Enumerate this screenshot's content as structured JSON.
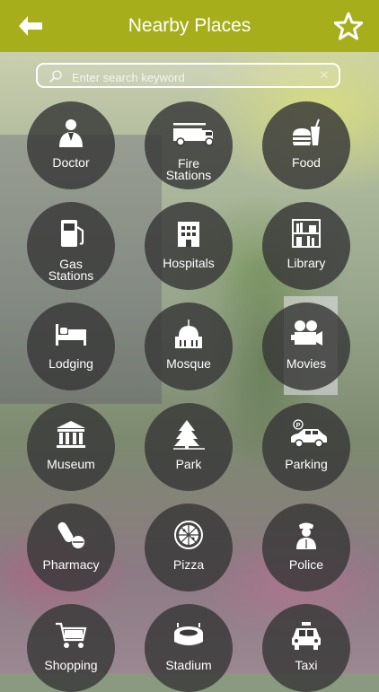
{
  "header": {
    "title": "Nearby Places",
    "accent_color": "#a6ae1c",
    "back_icon": "back-arrow-icon",
    "favorite_icon": "star-icon"
  },
  "search": {
    "placeholder": "Enter search keyword",
    "value": ""
  },
  "places": [
    {
      "label": "Doctor",
      "icon": "doctor-icon"
    },
    {
      "label": "Fire\nStations",
      "icon": "fire-truck-icon"
    },
    {
      "label": "Food",
      "icon": "food-icon"
    },
    {
      "label": "Gas\nStations",
      "icon": "gas-pump-icon"
    },
    {
      "label": "Hospitals",
      "icon": "hospital-icon"
    },
    {
      "label": "Library",
      "icon": "library-icon"
    },
    {
      "label": "Lodging",
      "icon": "bed-icon"
    },
    {
      "label": "Mosque",
      "icon": "mosque-icon"
    },
    {
      "label": "Movies",
      "icon": "movie-camera-icon"
    },
    {
      "label": "Museum",
      "icon": "museum-icon"
    },
    {
      "label": "Park",
      "icon": "tree-icon"
    },
    {
      "label": "Parking",
      "icon": "car-icon"
    },
    {
      "label": "Pharmacy",
      "icon": "pill-icon"
    },
    {
      "label": "Pizza",
      "icon": "pizza-icon"
    },
    {
      "label": "Police",
      "icon": "police-icon"
    },
    {
      "label": "Shopping",
      "icon": "shopping-cart-icon"
    },
    {
      "label": "Stadium",
      "icon": "stadium-icon"
    },
    {
      "label": "Taxi",
      "icon": "taxi-icon"
    }
  ]
}
